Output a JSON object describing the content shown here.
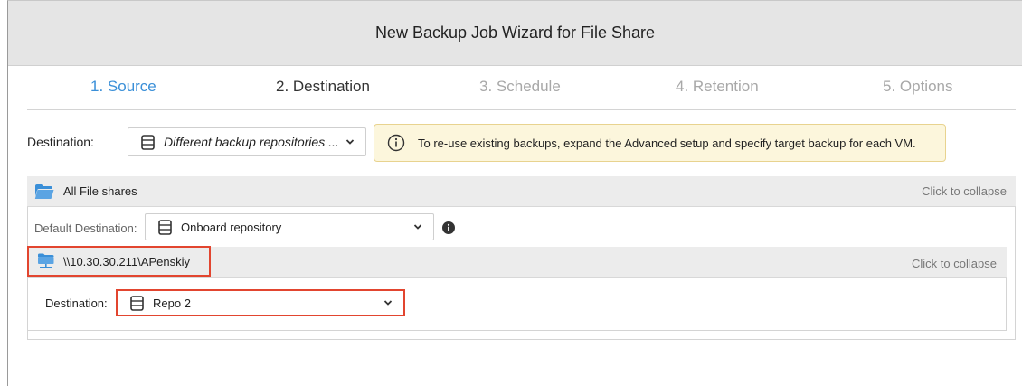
{
  "window": {
    "title": "New Backup Job Wizard for File Share"
  },
  "steps": [
    {
      "label": "1. Source",
      "state": "completed"
    },
    {
      "label": "2. Destination",
      "state": "current"
    },
    {
      "label": "3. Schedule",
      "state": "pending"
    },
    {
      "label": "4. Retention",
      "state": "pending"
    },
    {
      "label": "5. Options",
      "state": "pending"
    }
  ],
  "destination": {
    "label": "Destination:",
    "selected": "Different backup repositories ..."
  },
  "info_banner": {
    "text": "To re-use existing backups, expand the Advanced setup and specify target backup for each VM."
  },
  "group": {
    "title": "All File shares",
    "collapse_label": "Click to collapse",
    "default_destination_label": "Default Destination:",
    "default_destination_value": "Onboard repository"
  },
  "share": {
    "path": "\\\\10.30.30.211\\APenskiy",
    "collapse_label": "Click to collapse",
    "destination_label": "Destination:",
    "destination_value": "Repo 2"
  },
  "colors": {
    "accent": "#3a8fd8",
    "highlight_border": "#e2452f",
    "banner_bg": "#fcf6dc"
  }
}
